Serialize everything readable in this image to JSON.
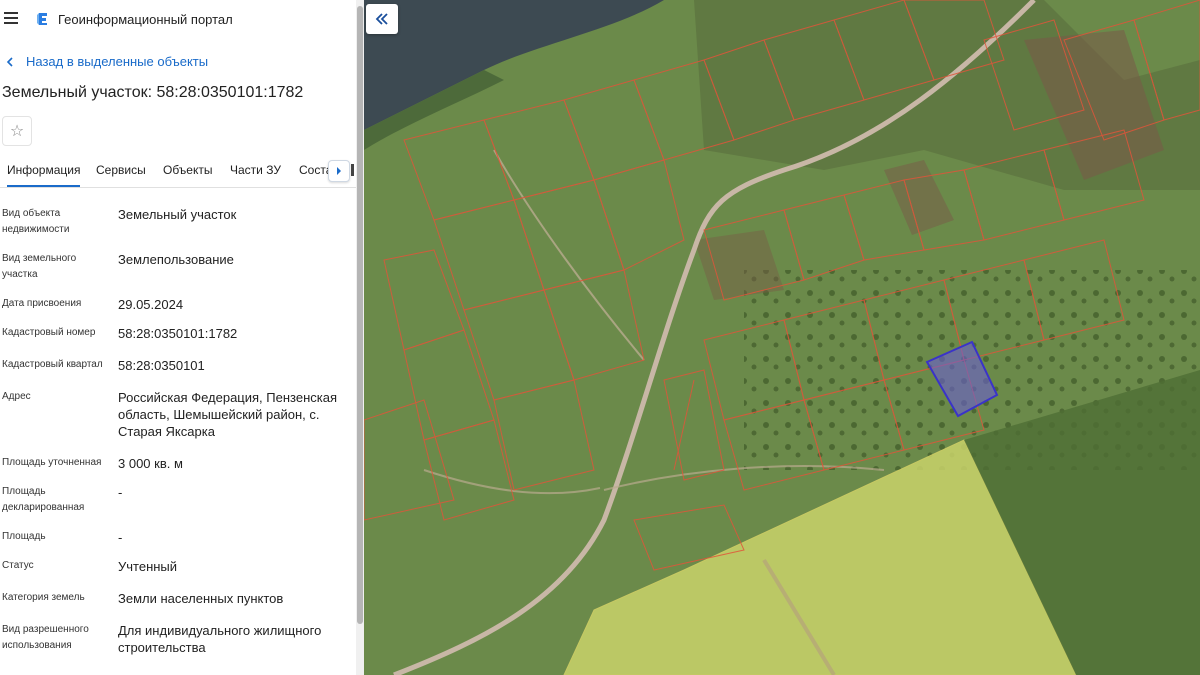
{
  "app": {
    "title": "Геоинформационный портал",
    "menu_icon": "hamburger-icon",
    "logo_icon": "portal-logo-icon"
  },
  "back_link": {
    "label": "Назад в выделенные объекты",
    "icon": "chevron-left-icon"
  },
  "object_title": "Земельный участок: 58:28:0350101:1782",
  "favorite_icon": "star-icon",
  "tabs": [
    {
      "label": "Информация",
      "active": true
    },
    {
      "label": "Сервисы",
      "active": false
    },
    {
      "label": "Объекты",
      "active": false
    },
    {
      "label": "Части ЗУ",
      "active": false
    },
    {
      "label": "Состав",
      "active": false
    }
  ],
  "tabs_scroll_icon": "chevron-right-icon",
  "fields": [
    {
      "label": "Вид объекта недвижимости",
      "value": "Земельный участок"
    },
    {
      "label": "Вид земельного участка",
      "value": "Землепользование"
    },
    {
      "label": "Дата присвоения",
      "value": "29.05.2024"
    },
    {
      "label": "Кадастровый номер",
      "value": "58:28:0350101:1782"
    },
    {
      "label": "Кадастровый квартал",
      "value": "58:28:0350101"
    },
    {
      "label": "Адрес",
      "value": "Российская Федерация, Пензенская область, Шемышейский район, с. Старая Яксарка"
    },
    {
      "label": "Площадь уточненная",
      "value": "3 000 кв. м"
    },
    {
      "label": "Площадь декларированная",
      "value": "-"
    },
    {
      "label": "Площадь",
      "value": "-"
    },
    {
      "label": "Статус",
      "value": "Учтенный"
    },
    {
      "label": "Категория земель",
      "value": "Земли населенных пунктов"
    },
    {
      "label": "Вид разрешенного использования",
      "value": "Для индивидуального жилищного строительства"
    }
  ],
  "map": {
    "collapse_icon": "double-chevron-left-icon",
    "colors": {
      "water": "#3d4a52",
      "ground": "#6b8a4a",
      "parcel_border": "#e0553a",
      "selected_fill": "#6a5fd0",
      "selected_border": "#3a33c9",
      "field_fill": "#c9d36a",
      "road": "#c8b7a6",
      "accent": "#1a6bc9"
    }
  }
}
